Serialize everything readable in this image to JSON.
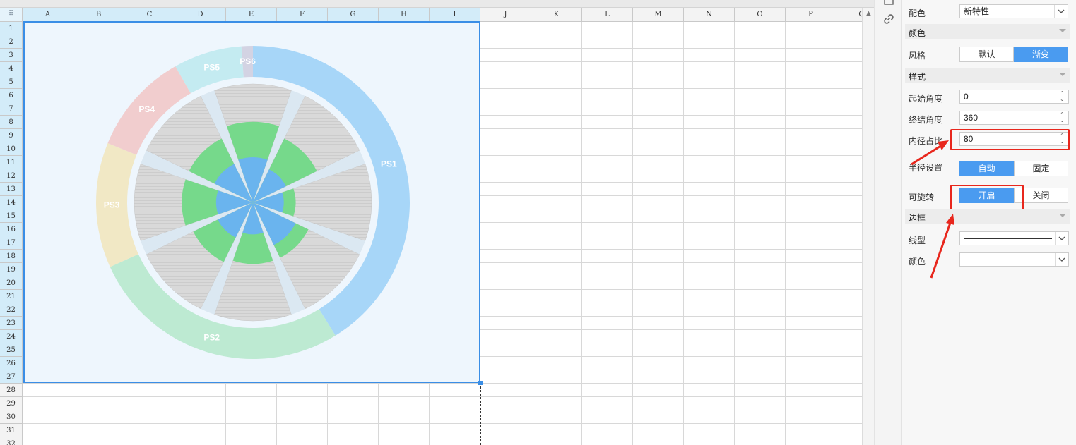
{
  "spreadsheet": {
    "columns": [
      "A",
      "B",
      "C",
      "D",
      "E",
      "F",
      "G",
      "H",
      "I",
      "J",
      "K",
      "L",
      "M",
      "N",
      "O",
      "P",
      "Q"
    ],
    "rows": [
      "1",
      "2",
      "3",
      "4",
      "5",
      "6",
      "7",
      "8",
      "9",
      "10",
      "11",
      "12",
      "13",
      "14",
      "15",
      "16",
      "17",
      "18",
      "19",
      "20",
      "21",
      "22",
      "23",
      "24",
      "25",
      "26",
      "27",
      "28",
      "29",
      "30",
      "31",
      "32"
    ]
  },
  "chart_data": {
    "type": "rose",
    "title": "",
    "ring_labels": [
      "PS1",
      "PS2",
      "PS3",
      "PS4",
      "PS5",
      "PS6"
    ],
    "ring_values": [
      35,
      23,
      11,
      9,
      6,
      1
    ],
    "ring_colors": [
      "#9fd3f7",
      "#b7e9cd",
      "#f1e7bf",
      "#f1c9c9",
      "#bfeaf0",
      "#cfcfe0"
    ],
    "petals": [
      {
        "outer": 68,
        "inner": 38
      },
      {
        "outer": 60,
        "inner": 31
      },
      {
        "outer": 36,
        "inner": 26
      },
      {
        "outer": 52,
        "inner": 40
      },
      {
        "outer": 52,
        "inner": 27
      },
      {
        "outer": 56,
        "inner": 33
      },
      {
        "outer": 60,
        "inner": 31
      },
      {
        "outer": 60,
        "inner": 36
      }
    ],
    "max": 100,
    "series_colors": {
      "outer": "#76d98b",
      "inner": "#6ab4ee"
    },
    "grid": true
  },
  "panel": {
    "color_scheme_label": "配色",
    "color_scheme_value": "新特性",
    "color_section": "颜色",
    "style_label": "风格",
    "style_options": [
      "默认",
      "渐变"
    ],
    "style_active": 1,
    "pattern_section": "样式",
    "start_angle_label": "起始角度",
    "start_angle_value": "0",
    "end_angle_label": "终结角度",
    "end_angle_value": "360",
    "inner_ratio_label": "内径占比",
    "inner_ratio_value": "80",
    "radius_label": "半径设置",
    "radius_options": [
      "自动",
      "固定"
    ],
    "radius_active": 0,
    "rotate_label": "可旋转",
    "rotate_options": [
      "开启",
      "关闭"
    ],
    "rotate_active": 0,
    "border_section": "边框",
    "line_type_label": "线型",
    "border_color_label": "颜色"
  },
  "accent_color": "#4a9bf0",
  "highlight_color": "#e8271d",
  "icons": {
    "toolbar": [
      "panel-icon",
      "link-icon"
    ],
    "arrows": [
      "red-arrow-icon"
    ]
  }
}
